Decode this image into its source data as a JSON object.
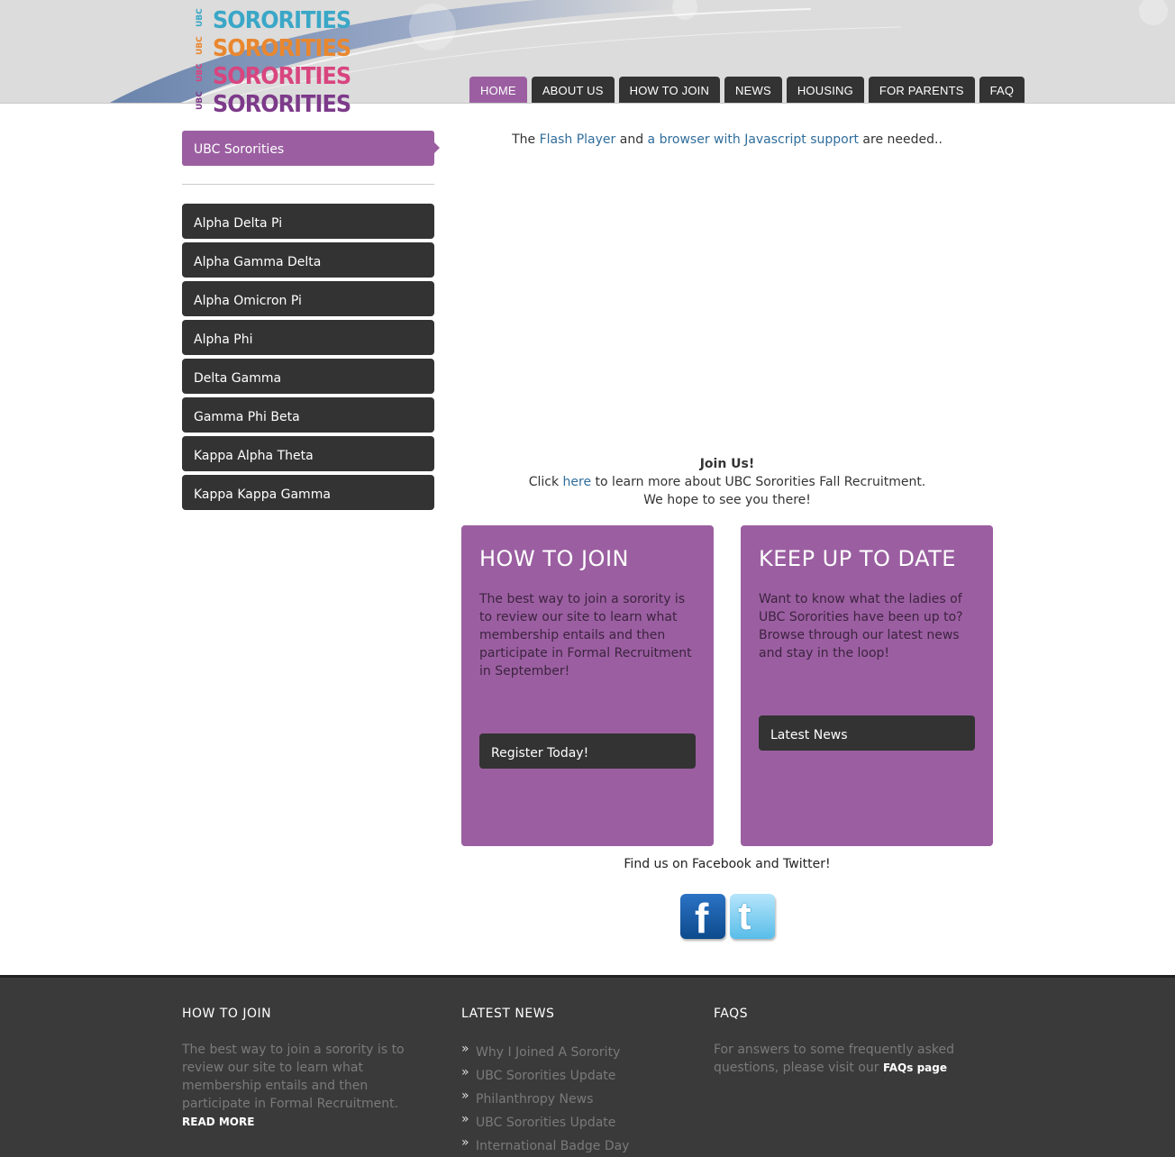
{
  "logo": {
    "side_text": [
      "UBC",
      "UBC",
      "UBC",
      "UBC"
    ],
    "words": [
      "SORORITIES",
      "SORORITIES",
      "SORORITIES",
      "SORORITIES"
    ]
  },
  "nav": {
    "items": [
      "HOME",
      "ABOUT US",
      "HOW TO JOIN",
      "NEWS",
      "HOUSING",
      "FOR PARENTS",
      "FAQ"
    ],
    "active": "HOME"
  },
  "sidebar": {
    "active_label": "UBC Sororities",
    "items": [
      "Alpha Delta Pi",
      "Alpha Gamma Delta",
      "Alpha Omicron Pi",
      "Alpha Phi",
      "Delta Gamma",
      "Gamma Phi Beta",
      "Kappa Alpha Theta",
      "Kappa Kappa Gamma"
    ]
  },
  "flash": {
    "prefix": "The ",
    "link1": "Flash Player",
    "middle": " and ",
    "link2": "a browser with Javascript support",
    "suffix": " are needed.."
  },
  "join": {
    "title": "Join Us!",
    "line_prefix": "Click ",
    "link": "here",
    "line_suffix": " to learn more about UBC Sororities Fall Recruitment.",
    "line2": "We hope to see you there!"
  },
  "boxes": {
    "how_to_join": {
      "title": "HOW TO JOIN",
      "text": "The best way to join a sorority is to review our site to learn what membership entails and then participate in Formal Recruitment in September!",
      "button": "Register Today!"
    },
    "keep_up": {
      "title": "KEEP UP TO DATE",
      "text": "Want to know what the ladies of UBC Sororities have been up to? Browse through our latest news and stay in the loop!",
      "button": "Latest News"
    }
  },
  "social": {
    "text": "Find us on Facebook and Twitter!",
    "icons": [
      "facebook-icon",
      "twitter-icon"
    ]
  },
  "footer": {
    "col1": {
      "title": "HOW TO JOIN",
      "text": "The best way to join a sorority is to review our site to learn what membership entails and then participate in Formal Recruitment.",
      "more": "READ MORE"
    },
    "col2": {
      "title": "LATEST NEWS",
      "items": [
        "Why I Joined A Sorority",
        "UBC Sororities Update",
        "Philanthropy News",
        "UBC Sororities Update",
        "International Badge Day"
      ]
    },
    "col3": {
      "title": "FAQS",
      "text": "For answers to some frequently asked questions, please visit our ",
      "link": "FAQs page"
    }
  },
  "colors": {
    "accent": "#9b5fa1",
    "dark": "#333333",
    "link": "#2f6d9b",
    "footer_bg": "#3a3a3a"
  }
}
